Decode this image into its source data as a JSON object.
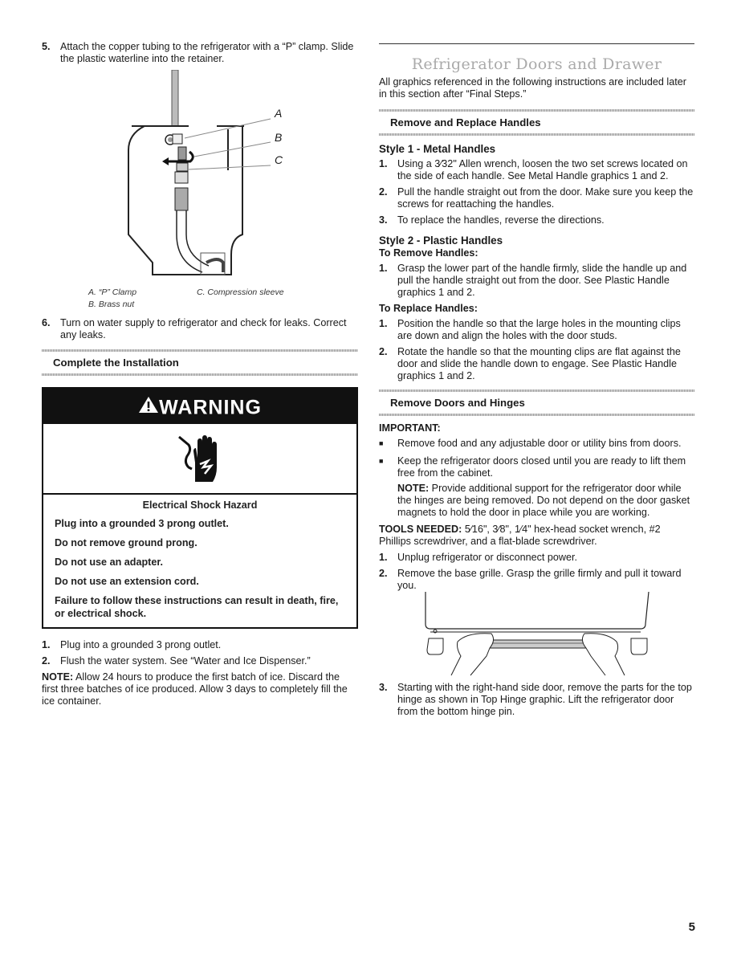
{
  "left": {
    "step5": {
      "num": "5.",
      "text": "Attach the copper tubing to the refrigerator with a “P” clamp. Slide the plastic waterline into the retainer."
    },
    "figure_labels": {
      "a": "A",
      "b": "B",
      "c": "C"
    },
    "captions": {
      "a": "A. “P” Clamp",
      "b": "B. Brass nut",
      "c": "C. Compression sleeve"
    },
    "step6": {
      "num": "6.",
      "text": "Turn on water supply to refrigerator and check for leaks. Correct any leaks."
    },
    "section_complete": "Complete the Installation",
    "warning": {
      "title": "WARNING",
      "hazard": "Electrical Shock Hazard",
      "lines": [
        "Plug into a grounded 3 prong outlet.",
        "Do not remove ground prong.",
        "Do not use an adapter.",
        "Do not use an extension cord.",
        "Failure to follow these instructions can result in death, fire, or electrical shock."
      ]
    },
    "steps": [
      {
        "num": "1.",
        "text": "Plug into a grounded 3 prong outlet."
      },
      {
        "num": "2.",
        "text": "Flush the water system. See “Water and Ice Dispenser.”"
      }
    ],
    "note": {
      "label": "NOTE:",
      "text": " Allow 24 hours to produce the first batch of ice. Discard the first three batches of ice produced. Allow 3 days to completely fill the ice container."
    }
  },
  "right": {
    "title": "Refrigerator Doors and Drawer",
    "intro": "All graphics referenced in the following instructions are included later in this section after “Final Steps.”",
    "section_handles": "Remove and Replace Handles",
    "style1": {
      "heading": "Style 1 - Metal Handles",
      "steps": [
        {
          "num": "1.",
          "text": "Using a 3⁄32\" Allen wrench, loosen the two set screws located on the side of each handle. See Metal Handle graphics 1 and  2."
        },
        {
          "num": "2.",
          "text": "Pull the handle straight out from the door. Make sure you keep the screws for reattaching the handles."
        },
        {
          "num": "3.",
          "text": "To replace the handles, reverse the directions."
        }
      ]
    },
    "style2": {
      "heading": "Style 2 - Plastic Handles",
      "remove_heading": "To Remove Handles:",
      "remove_steps": [
        {
          "num": "1.",
          "text": "Grasp the lower part of the handle firmly, slide the handle up and pull the handle straight out from the door. See Plastic Handle graphics 1 and 2."
        }
      ],
      "replace_heading": "To Replace Handles:",
      "replace_steps": [
        {
          "num": "1.",
          "text": "Position the handle so that the large holes in the mounting clips are down and align the holes with the door studs."
        },
        {
          "num": "2.",
          "text": "Rotate the handle so that the mounting clips are flat against the door and slide the handle down to engage. See Plastic Handle graphics 1 and 2."
        }
      ]
    },
    "section_doors": "Remove Doors and Hinges",
    "important": "IMPORTANT:",
    "bullets": [
      {
        "bullet": "■",
        "text": "Remove food and any adjustable door or utility bins from doors."
      },
      {
        "bullet": "■",
        "text": "Keep the refrigerator doors closed until you are ready to lift them free from the cabinet."
      }
    ],
    "note": {
      "label": "NOTE:",
      "text": " Provide additional support for the refrigerator door while the hinges are being removed. Do not depend on the door gasket magnets to hold the door in place while you are working."
    },
    "tools": {
      "label": "TOOLS NEEDED:",
      "text": " 5⁄16\", 3⁄8\", 1⁄4\" hex-head socket wrench, #2 Phillips screwdriver, and a flat-blade screwdriver."
    },
    "steps": [
      {
        "num": "1.",
        "text": "Unplug refrigerator or disconnect power."
      },
      {
        "num": "2.",
        "text": "Remove the base grille. Grasp the grille firmly and pull it toward you."
      }
    ],
    "step3": {
      "num": "3.",
      "text": "Starting with the right-hand side door, remove the parts for the top hinge as shown in Top Hinge graphic. Lift the refrigerator door from the bottom hinge pin."
    }
  },
  "page_number": "5"
}
